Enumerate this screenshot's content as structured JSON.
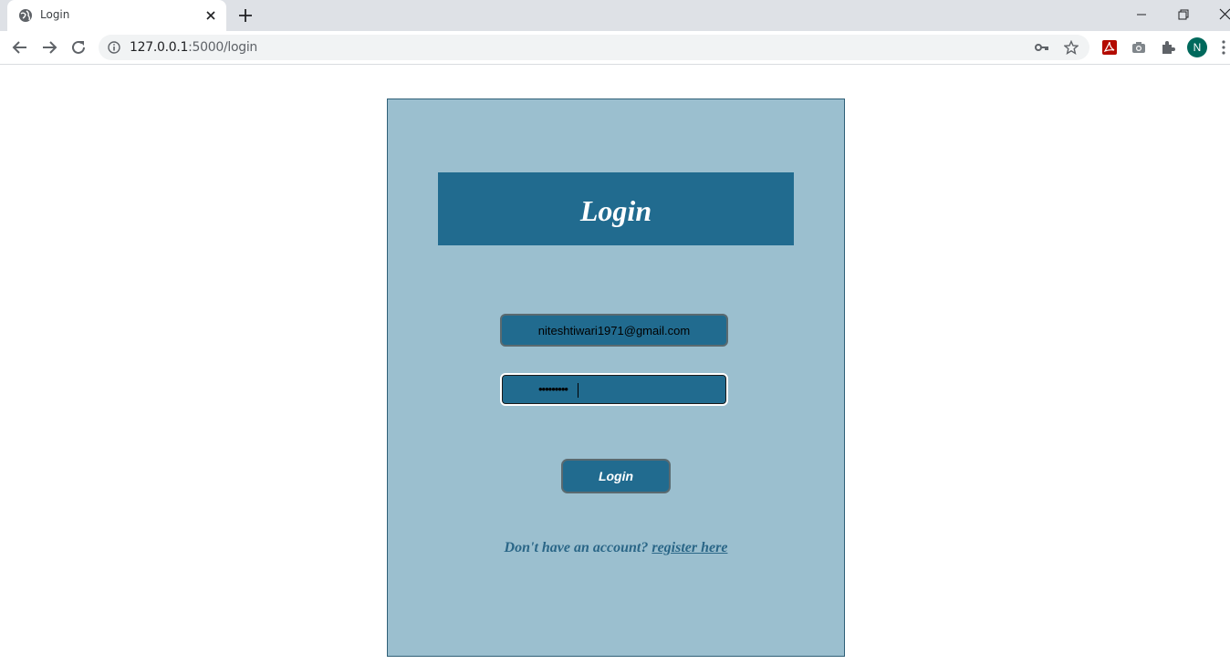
{
  "browser": {
    "tab_title": "Login",
    "url_host": "127.0.0.1",
    "url_path": ":5000/login",
    "profile_initial": "N"
  },
  "page": {
    "header_title": "Login",
    "email_value": "niteshtiwari1971@gmail.com",
    "password_masked": "•••••••••",
    "login_button_label": "Login",
    "register_prompt": "Don't have an account?",
    "register_link_label": "register here"
  },
  "colors": {
    "card_bg": "#9bbfcf",
    "accent": "#216b8f",
    "link": "#2a6687"
  },
  "icons": [
    "globe-icon",
    "close-icon",
    "plus-icon",
    "minimize-icon",
    "restore-icon",
    "window-close-icon",
    "back-arrow-icon",
    "forward-arrow-icon",
    "reload-icon",
    "info-icon",
    "key-icon",
    "star-icon",
    "pdf-extension-icon",
    "camera-extension-icon",
    "puzzle-extensions-icon",
    "kebab-menu-icon"
  ]
}
